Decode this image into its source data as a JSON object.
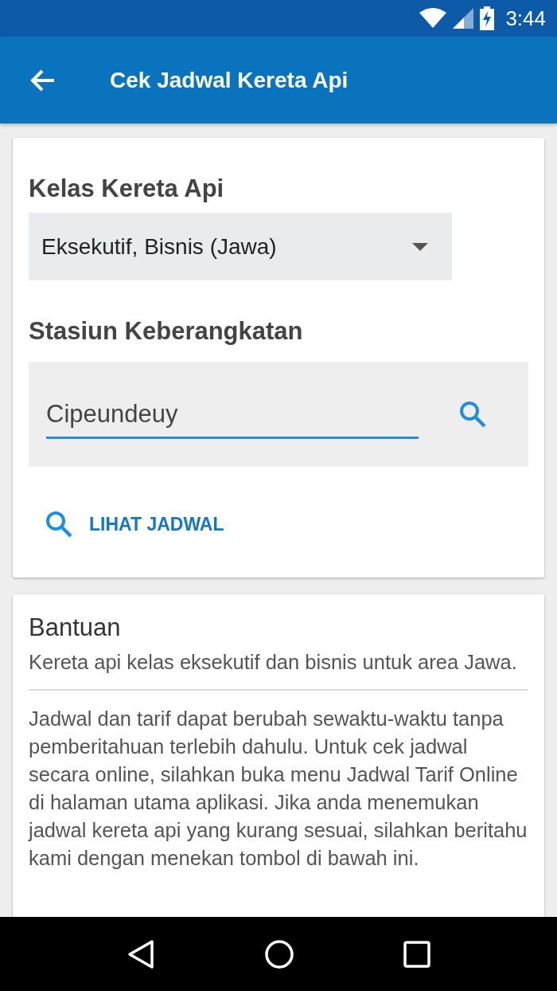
{
  "status_bar": {
    "time": "3:44"
  },
  "app_bar": {
    "title": "Cek Jadwal Kereta Api"
  },
  "form": {
    "class_label": "Kelas Kereta Api",
    "class_value": "Eksekutif, Bisnis (Jawa)",
    "station_label": "Stasiun Keberangkatan",
    "station_value": "Cipeundeuy",
    "action": "LIHAT JADWAL"
  },
  "help": {
    "title": "Bantuan",
    "summary": "Kereta api kelas eksekutif dan bisnis untuk area Jawa.",
    "body": "Jadwal dan tarif dapat berubah sewaktu-waktu tanpa pemberitahuan terlebih dahulu. Untuk cek jadwal secara online, silahkan buka menu Jadwal Tarif Online di halaman utama aplikasi. Jika anda menemukan jadwal kereta api yang kurang sesuai, silahkan beritahu kami dengan menekan tombol di bawah ini."
  }
}
